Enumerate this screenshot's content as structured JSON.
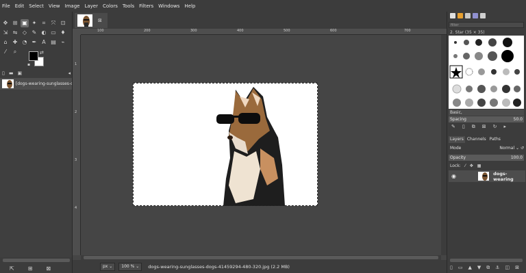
{
  "menu": [
    "File",
    "Edit",
    "Select",
    "View",
    "Image",
    "Layer",
    "Colors",
    "Tools",
    "Filters",
    "Windows",
    "Help"
  ],
  "colors": {
    "foreground": "#000000",
    "background": "#ffffff"
  },
  "images_panel": {
    "item_name": "[dogs-wearing-sunglasses-do"
  },
  "ruler": {
    "top_ticks": [
      "100",
      "200",
      "300",
      "400",
      "500",
      "600",
      "700"
    ],
    "left_ticks": [
      "1",
      "2",
      "3",
      "4"
    ]
  },
  "status": {
    "unit": "px",
    "zoom": "100 %",
    "text": "dogs-wearing-sunglasses-dogs-41459294-480-320.jpg (2.2 MB)"
  },
  "brushes": {
    "filter_placeholder": "filter",
    "current": "2. Star (35 × 35)",
    "tag": "Basic,",
    "spacing_label": "Spacing",
    "spacing_value": "50.0"
  },
  "layers": {
    "tabs": [
      "Layers",
      "Channels",
      "Paths"
    ],
    "mode_label": "Mode",
    "mode_value": "Normal",
    "opacity_label": "Opacity",
    "opacity_value": "100.0",
    "lock_label": "Lock:",
    "layer_name": "dogs-wearing"
  }
}
